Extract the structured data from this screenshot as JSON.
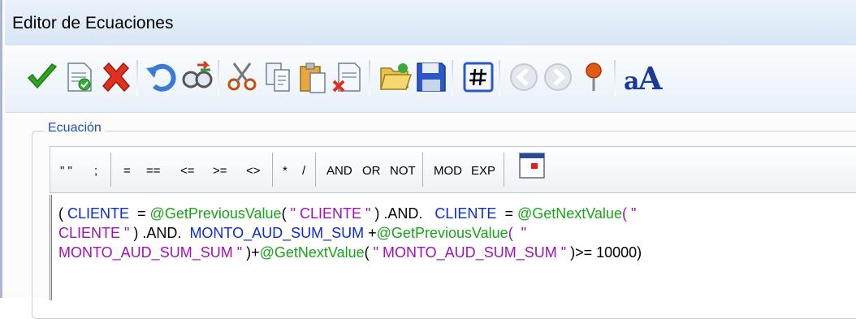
{
  "window": {
    "title": "Editor de Ecuaciones"
  },
  "toolbar": {
    "icons": [
      "accept-icon",
      "new-document-icon",
      "cancel-icon",
      "undo-icon",
      "find-replace-icon",
      "cut-icon",
      "copy-icon",
      "paste-icon",
      "delete-document-icon",
      "open-folder-icon",
      "save-icon",
      "hash-icon",
      "back-icon",
      "forward-icon",
      "pin-icon",
      "font-icon"
    ]
  },
  "group": {
    "label": "Ecuación"
  },
  "operators": {
    "quotes": "\" \"",
    "semicolon": ";",
    "eq": "=",
    "eqeq": "==",
    "le": "<=",
    "ge": ">=",
    "ne": "<>",
    "mul": "*",
    "div": "/",
    "and": "AND",
    "or": "OR",
    "not": "NOT",
    "mod": "MOD",
    "exp": "EXP"
  },
  "equation": {
    "line1": [
      {
        "t": "( ",
        "c": "op"
      },
      {
        "t": "CLIENTE",
        "c": "var"
      },
      {
        "t": "  = ",
        "c": "op"
      },
      {
        "t": "@GetPreviousValue",
        "c": "fn"
      },
      {
        "t": "( ",
        "c": "op"
      },
      {
        "t": "\" CLIENTE \"",
        "c": "str"
      },
      {
        "t": " ) .AND.   ",
        "c": "op"
      },
      {
        "t": "CLIENTE",
        "c": "var"
      },
      {
        "t": "  = ",
        "c": "op"
      },
      {
        "t": "@GetNextValue",
        "c": "fn"
      },
      {
        "t": "( \"",
        "c": "str"
      }
    ],
    "line2": [
      {
        "t": "CLIENTE \"",
        "c": "str"
      },
      {
        "t": " ) .AND.  ",
        "c": "op"
      },
      {
        "t": "MONTO_AUD_SUM_SUM",
        "c": "var"
      },
      {
        "t": " +",
        "c": "op"
      },
      {
        "t": "@GetPreviousValue",
        "c": "fn"
      },
      {
        "t": "(  \"",
        "c": "str"
      }
    ],
    "line3": [
      {
        "t": "MONTO_AUD_SUM_SUM \"",
        "c": "str"
      },
      {
        "t": " )+",
        "c": "op"
      },
      {
        "t": "@GetNextValue",
        "c": "fn"
      },
      {
        "t": "( ",
        "c": "op"
      },
      {
        "t": "\" MONTO_AUD_SUM_SUM \"",
        "c": "str"
      },
      {
        "t": " )>= 10000)",
        "c": "op"
      }
    ]
  }
}
